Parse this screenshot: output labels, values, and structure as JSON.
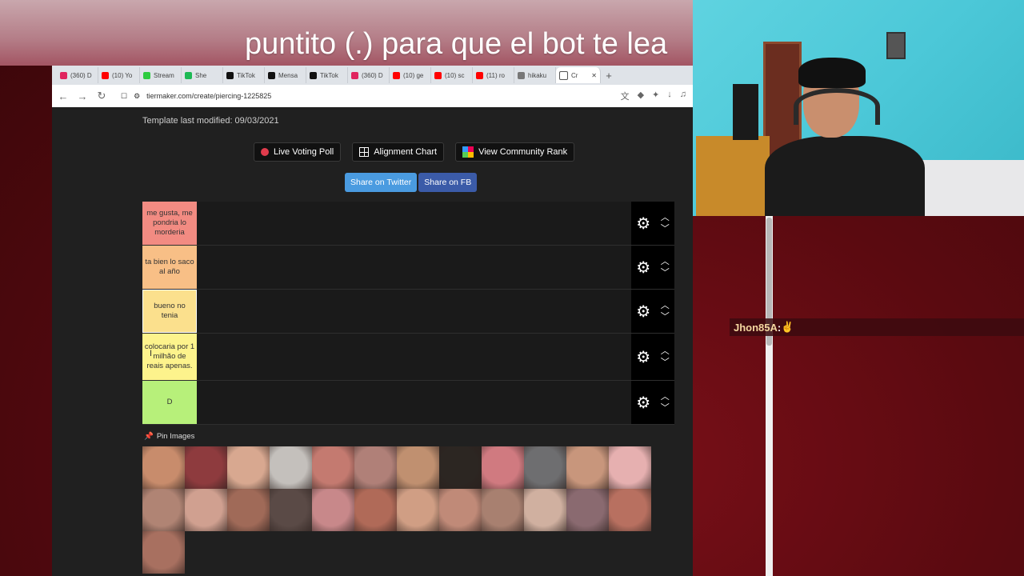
{
  "overlay": {
    "caption": "puntito (.) para que el bot te lea",
    "chat_user": "Jhon85A",
    "chat_separator": " : ",
    "chat_message": "✌"
  },
  "browser": {
    "tabs": [
      {
        "label": "(360) D",
        "color": "#e0245e"
      },
      {
        "label": "(10) Yo",
        "color": "#ff0000"
      },
      {
        "label": "Stream",
        "color": "#2ecc40"
      },
      {
        "label": "She",
        "color": "#1db954"
      },
      {
        "label": "TikTok",
        "color": "#111111"
      },
      {
        "label": "Mensa",
        "color": "#111111"
      },
      {
        "label": "TikTok",
        "color": "#111111"
      },
      {
        "label": "(360) D",
        "color": "#e0245e"
      },
      {
        "label": "(10) ge",
        "color": "#ff0000"
      },
      {
        "label": "(10) sc",
        "color": "#ff0000"
      },
      {
        "label": "(11) ro",
        "color": "#ff0000"
      },
      {
        "label": "hikaku",
        "color": "#777777"
      },
      {
        "label": "Cr",
        "color": "#ffffff",
        "active": true
      }
    ],
    "url": "tiermaker.com/create/piercing-1225825"
  },
  "page": {
    "template_modified": "Template last modified: 09/03/2021",
    "buttons": {
      "live_voting": "Live Voting Poll",
      "alignment": "Alignment Chart",
      "community": "View Community Rank",
      "share_twitter": "Share on Twitter",
      "share_fb": "Share on FB"
    },
    "tiers": [
      {
        "label": "me gusta, me pondria lo morderia",
        "color": "#f28b82",
        "height": 54
      },
      {
        "label": "ta bien lo saco al año",
        "color": "#f8bf86",
        "height": 54
      },
      {
        "label": "bueno no tenia",
        "color": "#fbe08d",
        "height": 54
      },
      {
        "label": "colocaria por 1 milhão de reais apenas.",
        "color": "#fdf38c",
        "height": 58
      },
      {
        "label": "D",
        "color": "#b7f07a",
        "height": 54
      }
    ],
    "pin_images": "Pin Images",
    "thumbnails": [
      "#c88c6c",
      "#8e3b3e",
      "#d8a890",
      "#c4c0bc",
      "#c47a70",
      "#b08078",
      "#c09070",
      "#2c2622",
      "#d07a80",
      "#6e6e70",
      "#c8967c",
      "#e6b0b0",
      "#b08474",
      "#d0a090",
      "#a06a58",
      "#5a4a46",
      "#c8888a",
      "#b06a58",
      "#d09e84",
      "#c08a78",
      "#a88070",
      "#d0b0a0",
      "#8a6a70",
      "#b87060",
      "#a87060"
    ]
  }
}
